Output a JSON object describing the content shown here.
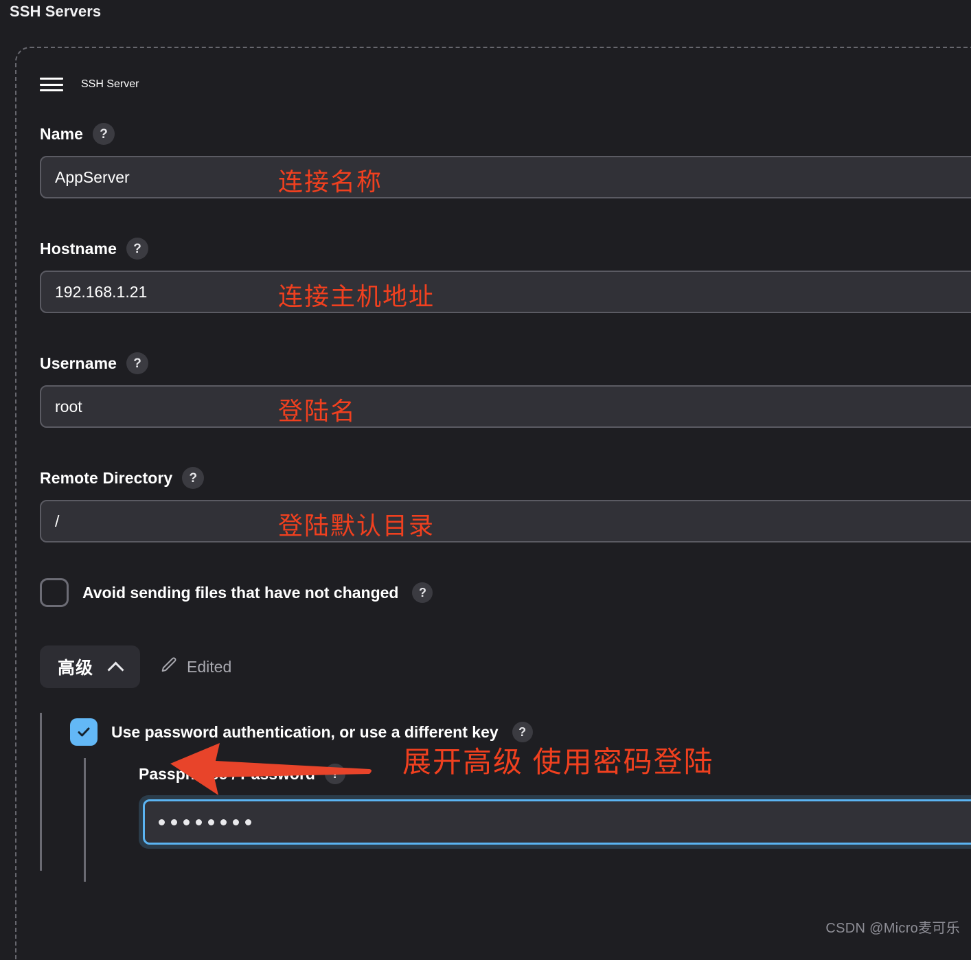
{
  "page": {
    "heading": "SSH Servers",
    "watermark": "CSDN @Micro麦可乐"
  },
  "panel": {
    "title": "SSH Server",
    "menu_icon": "hamburger-icon",
    "help_glyph": "?"
  },
  "fields": [
    {
      "label": "Name",
      "value": "AppServer",
      "annotation": "连接名称"
    },
    {
      "label": "Hostname",
      "value": "192.168.1.21",
      "annotation": "连接主机地址"
    },
    {
      "label": "Username",
      "value": "root",
      "annotation": "登陆名"
    },
    {
      "label": "Remote Directory",
      "value": "/",
      "annotation": "登陆默认目录"
    }
  ],
  "avoid_sending": {
    "label": "Avoid sending files that have not changed",
    "checked": false
  },
  "advanced": {
    "button_label": "高级",
    "chevron": "chevron-up-icon",
    "edited_icon": "pencil-icon",
    "edited_label": "Edited",
    "annotation": "展开高级 使用密码登陆",
    "password_auth": {
      "label": "Use password authentication, or use a different key",
      "checked": true
    },
    "passphrase": {
      "label": "Passphrase / Password",
      "value": "••••••••",
      "dot_count": 8
    }
  },
  "colors": {
    "page_bg": "#1e1e22",
    "input_bg": "#313137",
    "input_border": "#5b5b63",
    "annotation_red": "#f0401f",
    "accent_blue": "#63b8f6",
    "dashed_border": "#67676e"
  }
}
